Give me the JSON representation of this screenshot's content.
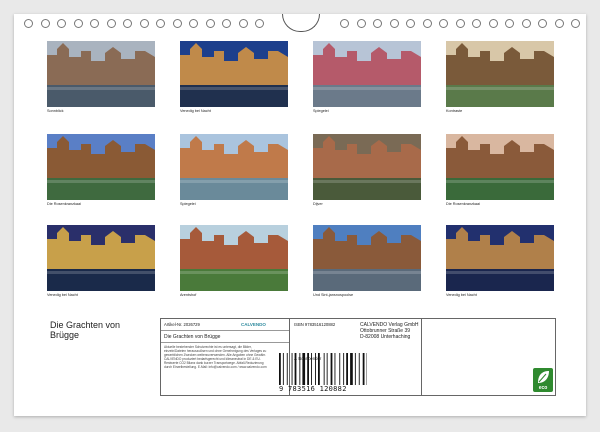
{
  "calendar": {
    "title_line1": "Die Grachten von",
    "title_line2": "Brügge"
  },
  "photos": [
    {
      "caption": "Sonnblick",
      "sky": "#a9b3bf",
      "mid": "#8a6b55",
      "low": "#4a5a6a"
    },
    {
      "caption": "Venedig bei Nacht",
      "sky": "#1d3f8c",
      "mid": "#c08a4a",
      "low": "#20304e"
    },
    {
      "caption": "Spiegelei",
      "sky": "#b7c4d6",
      "mid": "#b55a6a",
      "low": "#6b7a8a"
    },
    {
      "caption": "Kontraste",
      "sky": "#d8c7a8",
      "mid": "#7a5a3a",
      "low": "#5a7a4a"
    },
    {
      "caption": "Die Rosenkranzkaai",
      "sky": "#5a7fc6",
      "mid": "#8a5a35",
      "low": "#3f6a3f"
    },
    {
      "caption": "Spiegelei",
      "sky": "#aac4de",
      "mid": "#c07a4a",
      "low": "#6a8a9a"
    },
    {
      "caption": "Dijver",
      "sky": "#7a6a55",
      "mid": "#a86a4a",
      "low": "#4a5a3a"
    },
    {
      "caption": "Die Rosenkranzkaai",
      "sky": "#d9b7a0",
      "mid": "#8a5a3a",
      "low": "#3a6a3a"
    },
    {
      "caption": "Venedig bei Nacht",
      "sky": "#2a2f6a",
      "mid": "#c8a04a",
      "low": "#1a2a4a"
    },
    {
      "caption": "Arentshof",
      "sky": "#b8d0de",
      "mid": "#a65a3a",
      "low": "#4a7a3a"
    },
    {
      "caption": "Und Sint-jansnospoolse",
      "sky": "#4f7fc0",
      "mid": "#8a5a3a",
      "low": "#5a6a7a"
    },
    {
      "caption": "Venedig bei Nacht",
      "sky": "#22306e",
      "mid": "#b0804a",
      "low": "#1a264e"
    }
  ],
  "info": {
    "artikel": "Artikel-Nr. 2026729",
    "calvendo": "CALVENDO",
    "title": "Die Grachten von Brügge",
    "blurb": "Aktuelle bestehender Schutzrechte ist es untersagt, die Bilder, einzeln/Dateien herauszulösen und ohne Genehmigung des Verlages zu gewerblichen Zwecken weiterzuverwenden. Alle Angaben ohne Gewähr. CALVENDO produziert bedarfsgerecht und klimaneutral in DE & EU. Restwerte CO2 Bilanz dank kurzer Transportwege. Abfall-Reduzierung durch Einzelbestellung. E-Mail: info@calvendo.com / www.calvendo.com",
    "isbn": "ISBN 9783516120882",
    "author": "J. Bonnbender",
    "publisher_line1": "CALVENDO Verlag GmbH",
    "publisher_line2": "Ottobrunner Straße 39",
    "publisher_line3": "D-82008 Unterhaching",
    "barcode_number": "9 783516 120882",
    "eco_label": "eco"
  }
}
